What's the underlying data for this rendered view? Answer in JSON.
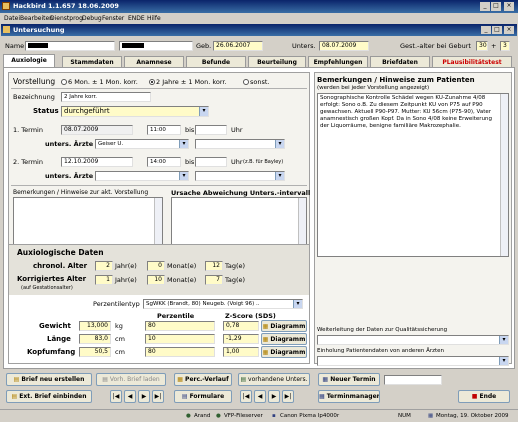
{
  "app": {
    "title": "Hackbird 1.1.657 18.06.2009"
  },
  "menu": [
    "Datei",
    "Bearbeiten",
    "Dienstprog",
    "Debug",
    "Fenster",
    "ENDE",
    "Hilfe"
  ],
  "window": {
    "title": "Untersuchung"
  },
  "header": {
    "name_label": "Name",
    "geb_label": "Geb.",
    "geb_value": "26.06.2007",
    "unters_label": "Unters.",
    "unters_value": "08.07.2009",
    "gestalter_label": "Gest.-alter bei Geburt",
    "gestalter_weeks": "30",
    "plus": "+",
    "gestalter_days": "3"
  },
  "tabs": [
    "Auxiologie",
    "Stammdaten",
    "Anamnese",
    "Befunde",
    "Beurteilung",
    "Empfehlungen",
    "Briefdaten",
    "PLausibilitätstest"
  ],
  "vorstellung": {
    "label": "Vorstellung",
    "options": [
      "6 Mon. ± 1 Mon. korr.",
      "2 Jahre ± 1 Mon. korr.",
      "sonst."
    ],
    "bezeichnung_label": "Bezeichnung",
    "bezeichnung_value": "2 Jahre korr.",
    "status_label": "Status",
    "status_value": "durchgeführt"
  },
  "termin1": {
    "label": "1. Termin",
    "date": "08.07.2009",
    "time": "11:00",
    "bis": "bis",
    "uhr": "Uhr",
    "aerzte_label": "unters. Ärzte",
    "arzt1": "Geiser U."
  },
  "termin2": {
    "label": "2. Termin",
    "date": "12.10.2009",
    "time": "14:00",
    "bis": "bis",
    "uhr": "Uhr",
    "note": "(z.B. für Bayley)",
    "aerzte_label": "unters. Ärzte"
  },
  "bemerkungen_akt": {
    "label": "Bemerkungen / Hinweise zur akt. Vorstellung"
  },
  "ursache": {
    "label": "Ursache Abweichung Unters.-intervall"
  },
  "patient_notes": {
    "title": "Bemerkungen / Hinweise zum Patienten",
    "subtitle": "(werden bei jeder Vorstellung angezeigt)",
    "text": "Sonographische Kontrolle Schädel wegen KU-Zunahme 4/08 erfolgt: Sono o.B. Zu diesem Zeitpunkt KU von P75 auf P90 gewachsen. Aktuell P90-P97. Mutter: KU 56cm (P75-90), Vater anamnestisch großen Kopf. Da in Sono 4/08 keine Erweiterung der Liquorräume, benigne familiäre Makrozephalie."
  },
  "auxio": {
    "title": "Auxiologische Daten",
    "chron_label": "chronol. Alter",
    "chron": {
      "j": "2",
      "m": "0",
      "t": "12"
    },
    "korr_label": "Korrigiertes Alter",
    "korr_sub": "(auf Gestationsalter)",
    "korr": {
      "j": "1",
      "m": "10",
      "t": "7"
    },
    "jahre": "Jahr(e)",
    "monate": "Monat(e)",
    "tage": "Tag(e)",
    "perzentilentyp_label": "Perzentilentyp",
    "perzentilentyp_value": "SgWKK (Brandt, 80) Neugeb. (Voigt 96) ..",
    "col_perzentile": "Perzentile",
    "col_zscore": "Z-Score (SDS)",
    "rows": [
      {
        "label": "Gewicht",
        "value": "13,000",
        "unit": "kg",
        "perz": "80",
        "z": "0,78",
        "diag": "Diagramm"
      },
      {
        "label": "Länge",
        "value": "83,0",
        "unit": "cm",
        "perz": "10",
        "z": "-1,29",
        "diag": "Diagramm"
      },
      {
        "label": "Kopfumfang",
        "value": "50,5",
        "unit": "cm",
        "perz": "80",
        "z": "1,00",
        "diag": "Diagramm"
      }
    ]
  },
  "right_lower": {
    "weiterleitung": "Weiterleitung der Daten zur Qualitätssicherung",
    "einholung": "Einholung Patientendaten von anderen Ärzten"
  },
  "buttons": {
    "brief_neu": "Brief neu erstellen",
    "vorh_brief": "Vorh. Brief laden",
    "perc_verlauf": "Perc.-Verlauf",
    "vorh_unters": "vorhandene Unters.",
    "neuer_termin": "Neuer Termin",
    "ext_brief": "Ext. Brief einbinden",
    "formulare": "Formulare",
    "terminmanager": "Terminmanager",
    "ende": "Ende"
  },
  "statusbar": {
    "user": "Arand",
    "server": "VFP-Fileserver",
    "printer": "Canon Pixma Ip4000r",
    "num": "NUM",
    "date": "Montag, 19. Oktober 2009"
  },
  "colors": {
    "titlebar": "#0a246a",
    "tab_red": "#cc0000",
    "field_yellow": "#fffbc8",
    "perz_yellow": "#fff9d0"
  }
}
